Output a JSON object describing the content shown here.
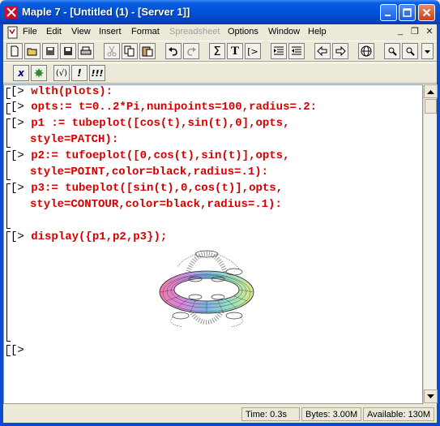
{
  "window": {
    "title": "Maple 7  - [Untitled (1) - [Server 1]]"
  },
  "menu": {
    "items": [
      {
        "label": "File"
      },
      {
        "label": "Edit"
      },
      {
        "label": "View"
      },
      {
        "label": "Insert"
      },
      {
        "label": "Format"
      },
      {
        "label": "Spreadsheet",
        "disabled": true
      },
      {
        "label": "Options"
      },
      {
        "label": "Window"
      },
      {
        "label": "Help"
      }
    ]
  },
  "toolbar1": {
    "icons": [
      "new-icon",
      "open-icon",
      "save-server-icon",
      "save-icon",
      "print-icon",
      "cut-icon",
      "copy-icon",
      "paste-icon",
      "undo-icon",
      "redo-icon",
      "sigma-icon",
      "text-icon",
      "input-prompt-icon",
      "indent-icon",
      "outdent-icon",
      "back-icon",
      "forward-icon",
      "globe-icon",
      "zoom-in-icon",
      "zoom-out-icon"
    ],
    "sigma": "Σ",
    "text": "T",
    "prompt": "[>"
  },
  "toolbar2": {
    "x_label": "x",
    "paren_label": "(√)",
    "bang_label": "!",
    "triple_bang_label": "!!!"
  },
  "worksheet": {
    "lines": [
      {
        "prompt": "[>",
        "code": "wlth(plots):"
      },
      {
        "prompt": "[>",
        "code": "opts:= t=0..2*Pi,nunipoints=100,radius=.2:"
      },
      {
        "prompt": "[>",
        "code": "p1 := tubeplot([cos(t),sin(t),0],opts,"
      },
      {
        "prompt": "",
        "code": "style=PATCH):"
      },
      {
        "prompt": "[>",
        "code": "p2:= tufoeplot([0,cos(t),sin(t)],opts,"
      },
      {
        "prompt": "",
        "code": "style=POINT,color=black,radius=.1):"
      },
      {
        "prompt": "[>",
        "code": "p3:= tubeplot([sin(t),0,cos(t)],opts,"
      },
      {
        "prompt": "",
        "code": "style=CONTOUR,color=black,radius=.1):"
      },
      {
        "prompt": "[>",
        "code": "display({p1,p2,p3});"
      },
      {
        "prompt": "[>",
        "code": ""
      }
    ]
  },
  "status": {
    "time": "Time:  0.3s",
    "bytes": "Bytes: 3.00M",
    "available": "Available: 130M"
  },
  "colors": {
    "code": "#d40000",
    "titlebar": "#0052d6"
  }
}
